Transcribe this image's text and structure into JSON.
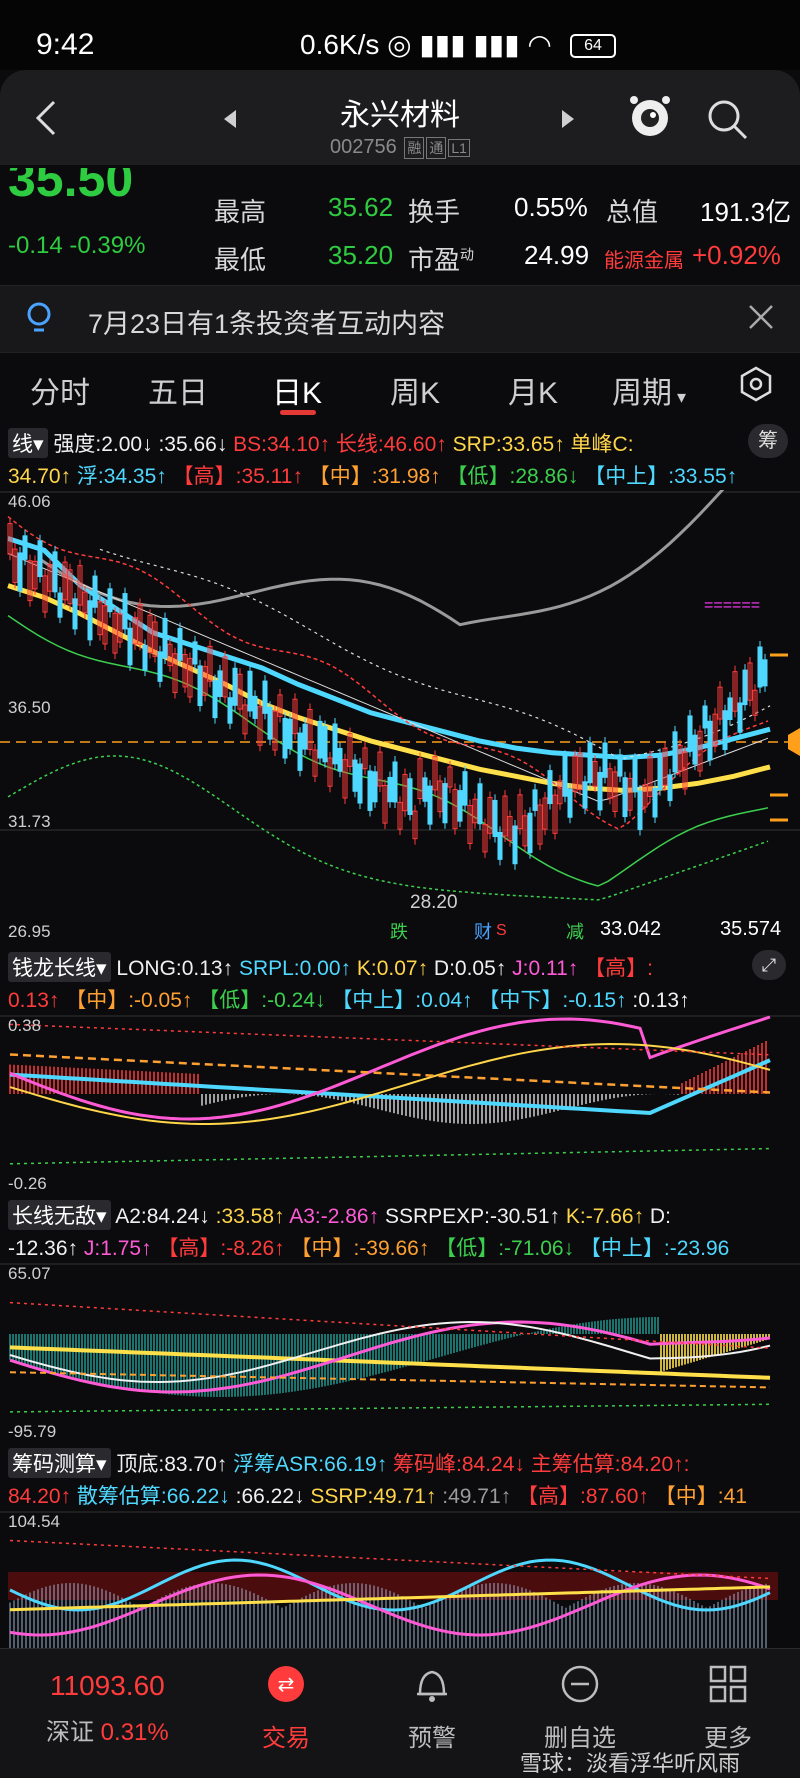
{
  "status": {
    "time": "9:42",
    "net": "0.6K/s",
    "battery": "64"
  },
  "header": {
    "title": "永兴材料",
    "code": "002756",
    "tag1": "融",
    "tag2": "通",
    "tag3": "L1"
  },
  "quote": {
    "price": "35.50",
    "change": "-0.14",
    "change_pct": "-0.39%",
    "high_label": "最高",
    "high": "35.62",
    "low_label": "最低",
    "low": "35.20",
    "turnover_label": "换手",
    "turnover": "0.55%",
    "pe_label": "市盈",
    "pe_sup": "动",
    "pe": "24.99",
    "mcap_label": "总值",
    "mcap": "191.3亿",
    "sector": "能源金属",
    "sector_pct": "+0.92%"
  },
  "notice": {
    "text": "7月23日有1条投资者互动内容"
  },
  "tabs": [
    "分时",
    "五日",
    "日K",
    "周K",
    "月K",
    "周期"
  ],
  "main_chart": {
    "selector": "线",
    "row1": [
      {
        "t": "强度:2.00↓",
        "c": "white"
      },
      {
        "t": ":35.66↓",
        "c": "white"
      },
      {
        "t": "BS:34.10↑",
        "c": "red"
      },
      {
        "t": "长线:46.60↑",
        "c": "red"
      },
      {
        "t": "SRP:33.65↑",
        "c": "yellow"
      },
      {
        "t": "单峰C:",
        "c": "yellow"
      }
    ],
    "side_btn": "筹",
    "row2": [
      {
        "t": "34.70↑",
        "c": "yellow"
      },
      {
        "t": "浮:34.35↑",
        "c": "cyan"
      },
      {
        "t": "【高】:35.11↑",
        "c": "red"
      },
      {
        "t": "【中】:31.98↑",
        "c": "orange"
      },
      {
        "t": "【低】:28.86↓",
        "c": "green"
      },
      {
        "t": "【中上】:33.55↑",
        "c": "cyan"
      }
    ],
    "y_top": "46.06",
    "y_mid": "36.50",
    "y_low": "31.73",
    "y_bottom": "26.95",
    "low_label": "28.20",
    "right_label1": "33.042",
    "right_label2": "35.574",
    "markers": [
      "跌",
      "财",
      "S",
      "减"
    ],
    "chart_data": {
      "type": "line",
      "ylim": [
        26.95,
        46.06
      ],
      "series": [
        {
          "values": [
            44,
            43.5,
            42,
            41,
            40,
            39.5,
            39,
            38.5,
            37.8,
            37.2,
            36.6,
            36.2,
            35.8,
            35.4,
            35.1,
            34.9,
            34.8,
            34.7,
            34.8,
            35.1,
            35.5,
            35.9
          ]
        },
        {
          "values": [
            42,
            41.5,
            40.8,
            40,
            39.2,
            38.5,
            37.8,
            37.0,
            36.4,
            35.9,
            35.4,
            35.0,
            34.6,
            34.2,
            33.9,
            33.6,
            33.4,
            33.3,
            33.4,
            33.6,
            33.9,
            34.3
          ]
        }
      ]
    }
  },
  "ind2": {
    "selector": "钱龙长线",
    "row1": [
      {
        "t": "LONG:0.13↑",
        "c": "white"
      },
      {
        "t": "SRPL:0.00↑",
        "c": "cyan"
      },
      {
        "t": "K:0.07↑",
        "c": "yellow"
      },
      {
        "t": "D:0.05↑",
        "c": "white"
      },
      {
        "t": "J:0.11↑",
        "c": "magenta"
      },
      {
        "t": "【高】:",
        "c": "red"
      }
    ],
    "row2": [
      {
        "t": "0.13↑",
        "c": "red"
      },
      {
        "t": "【中】:-0.05↑",
        "c": "orange"
      },
      {
        "t": "【低】:-0.24↓",
        "c": "green"
      },
      {
        "t": "【中上】:0.04↑",
        "c": "cyan"
      },
      {
        "t": "【中下】:-0.15↑",
        "c": "cyan"
      },
      {
        "t": ":0.13↑",
        "c": "white"
      }
    ],
    "y_top": "0.38",
    "y_bottom": "-0.26"
  },
  "ind3": {
    "selector": "长线无敌",
    "row1": [
      {
        "t": "A2:84.24↓",
        "c": "white"
      },
      {
        "t": ":33.58↑",
        "c": "yellow"
      },
      {
        "t": "A3:-2.86↑",
        "c": "magenta"
      },
      {
        "t": "SSRPEXP:-30.51↑",
        "c": "white"
      },
      {
        "t": "K:-7.66↑",
        "c": "yellow"
      },
      {
        "t": "D:",
        "c": "white"
      }
    ],
    "row2": [
      {
        "t": "-12.36↑",
        "c": "white"
      },
      {
        "t": "J:1.75↑",
        "c": "magenta"
      },
      {
        "t": "【高】:-8.26↑",
        "c": "red"
      },
      {
        "t": "【中】:-39.66↑",
        "c": "orange"
      },
      {
        "t": "【低】:-71.06↓",
        "c": "green"
      },
      {
        "t": "【中上】:-23.96",
        "c": "cyan"
      }
    ],
    "y_top": "65.07",
    "y_bottom": "-95.79"
  },
  "ind4": {
    "selector": "筹码测算",
    "row1": [
      {
        "t": "顶底:83.70↑",
        "c": "white"
      },
      {
        "t": "浮筹ASR:66.19↑",
        "c": "cyan"
      },
      {
        "t": "筹码峰:84.24↓",
        "c": "red"
      },
      {
        "t": "主筹估算:84.20↑:",
        "c": "red"
      }
    ],
    "row2": [
      {
        "t": "84.20↑",
        "c": "red"
      },
      {
        "t": "散筹估算:66.22↓",
        "c": "cyan"
      },
      {
        "t": ":66.22↓",
        "c": "white"
      },
      {
        "t": "SSRP:49.71↑",
        "c": "yellow"
      },
      {
        "t": ":49.71↑",
        "c": "gray"
      },
      {
        "t": "【高】:87.60↑",
        "c": "red"
      },
      {
        "t": "【中】:41",
        "c": "orange"
      }
    ],
    "y_top": "104.54"
  },
  "bottom_nav": {
    "index_value": "11093.60",
    "index_name": "深证",
    "index_pct": "0.31%",
    "items": [
      "交易",
      "预警",
      "删自选",
      "更多"
    ]
  },
  "watermark": "雪球：淡看浮华听风雨",
  "colors": {
    "red": "#ff3b3b",
    "green": "#2ecc40",
    "cyan": "#4fd8ff",
    "yellow": "#ffe04a"
  }
}
